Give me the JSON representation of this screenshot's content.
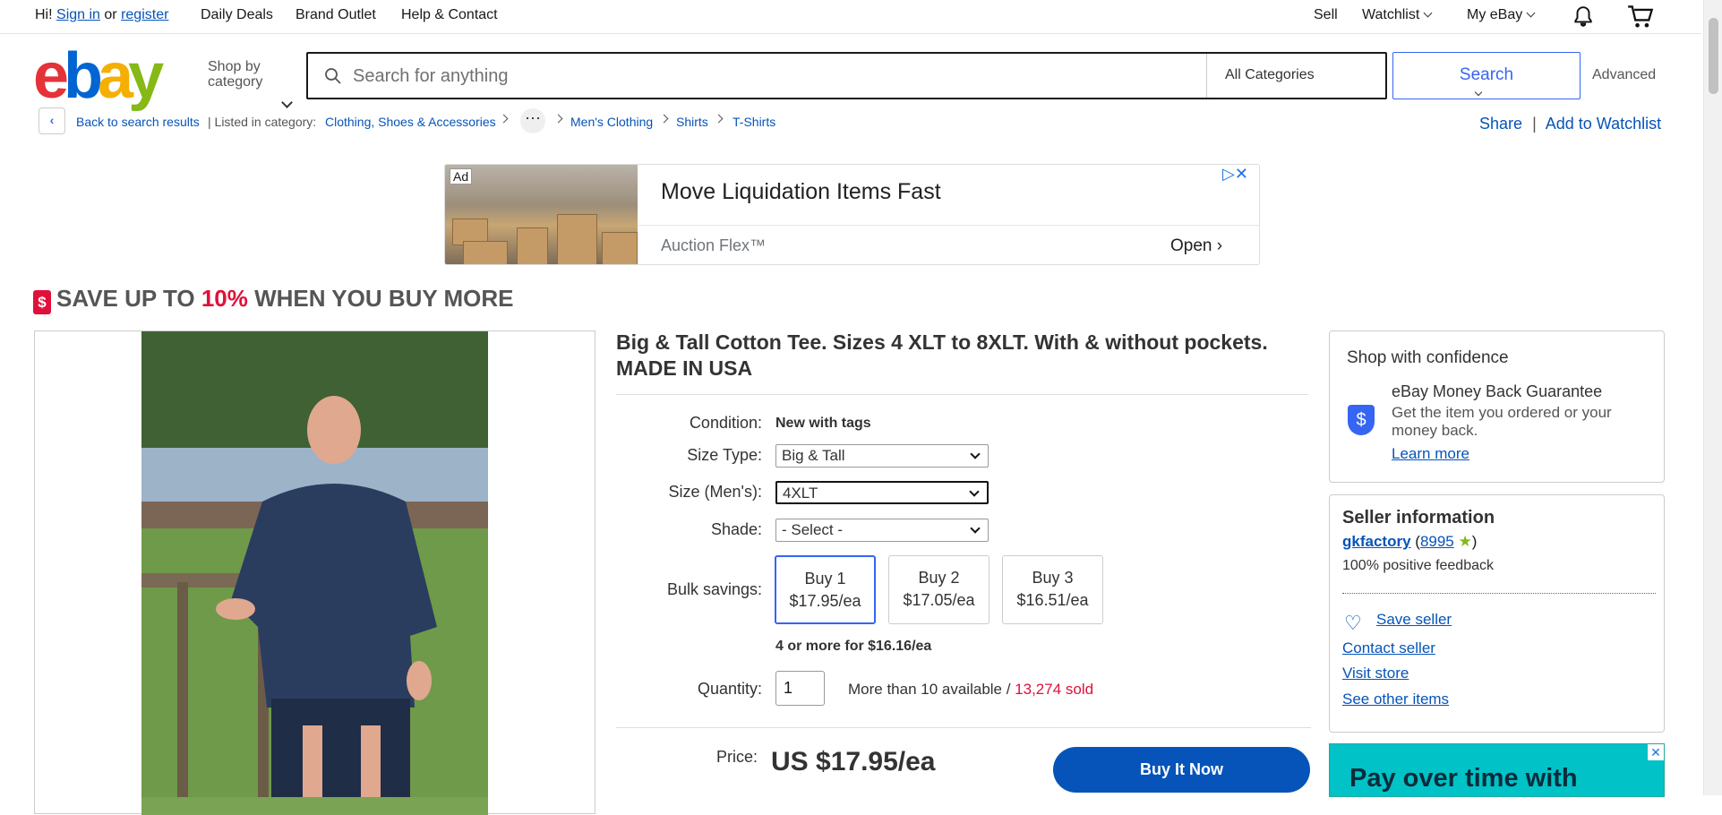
{
  "topbar": {
    "greeting": "Hi!",
    "sign_in": "Sign in",
    "or": "or",
    "register": "register",
    "daily_deals": "Daily Deals",
    "brand_outlet": "Brand Outlet",
    "help_contact": "Help & Contact",
    "sell": "Sell",
    "watchlist": "Watchlist",
    "my_ebay": "My eBay"
  },
  "header": {
    "logo": [
      "e",
      "b",
      "a",
      "y"
    ],
    "logo_colors": [
      "#e53238",
      "#0064d2",
      "#f5af02",
      "#86b817"
    ],
    "shop_by_1": "Shop by",
    "shop_by_2": "category",
    "search_placeholder": "Search for anything",
    "category": "All Categories",
    "search_button": "Search",
    "advanced": "Advanced"
  },
  "breadcrumb": {
    "back": "Back to search results",
    "listed_in": "Listed in category:",
    "items": [
      "Clothing, Shoes & Accessories",
      "Men's Clothing",
      "Shirts",
      "T-Shirts"
    ],
    "share": "Share",
    "add_watchlist": "Add to Watchlist"
  },
  "ad": {
    "label": "Ad",
    "title": "Move Liquidation Items Fast",
    "source": "Auction Flex™",
    "open": "Open"
  },
  "promo": {
    "prefix": "SAVE UP TO ",
    "percent": "10%",
    "suffix": " WHEN YOU BUY MORE"
  },
  "item": {
    "title": "Big & Tall Cotton Tee. Sizes 4 XLT to 8XLT. With & without pockets. MADE IN USA",
    "condition_label": "Condition:",
    "condition_value": "New with tags",
    "size_type_label": "Size Type:",
    "size_type_value": "Big & Tall",
    "size_label": "Size (Men's):",
    "size_value": "4XLT",
    "shade_label": "Shade:",
    "shade_value": "- Select -",
    "bulk_label": "Bulk savings:",
    "bulk": [
      {
        "qty": "Buy 1",
        "price": "$17.95/ea"
      },
      {
        "qty": "Buy 2",
        "price": "$17.05/ea"
      },
      {
        "qty": "Buy 3",
        "price": "$16.51/ea"
      }
    ],
    "bulk_more": "4 or more for $16.16/ea",
    "quantity_label": "Quantity:",
    "quantity_value": "1",
    "available": "More than 10 available / ",
    "sold": "13,274 sold",
    "price_label": "Price:",
    "price": "US $17.95/ea",
    "buy_now": "Buy It Now"
  },
  "confidence": {
    "heading": "Shop with confidence",
    "title": "eBay Money Back Guarantee",
    "desc": "Get the item you ordered or your money back.",
    "learn_more": "Learn more"
  },
  "seller": {
    "heading": "Seller information",
    "name": "gkfactory",
    "score": "8995",
    "positive": "100% positive feedback",
    "save": "Save seller",
    "contact": "Contact seller",
    "visit": "Visit store",
    "other": "See other items"
  },
  "side_ad": {
    "text": "Pay over time with"
  }
}
